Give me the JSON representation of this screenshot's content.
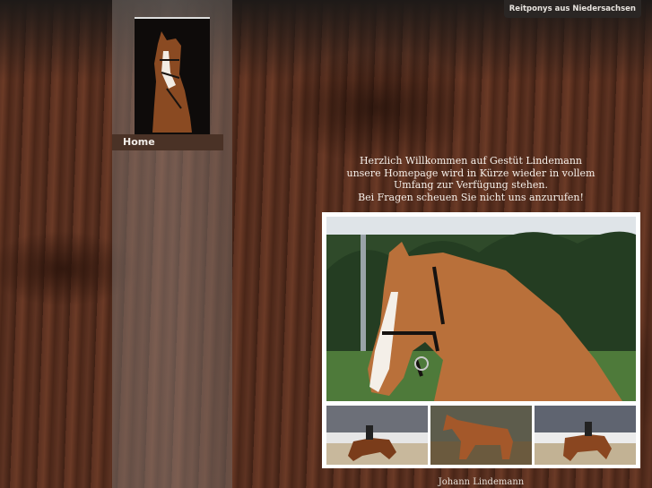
{
  "brand": {
    "label": "Reitponys aus Niedersachsen"
  },
  "nav": {
    "home_label": "Home"
  },
  "welcome": {
    "line1": "Herzlich Willkommen auf Gestüt Lindemann",
    "line2": "unsere Homepage wird in Kürze wieder in vollem",
    "line3": "Umfang zur Verfügung stehen.",
    "line4": "Bei Fragen scheuen Sie nicht uns anzurufen!"
  },
  "footer": {
    "name": "Johann Lindemann"
  },
  "colors": {
    "wood": "#55301f",
    "sidebar": "#8c807a",
    "nav_bg": "#4a3226",
    "frame": "#ffffff"
  }
}
